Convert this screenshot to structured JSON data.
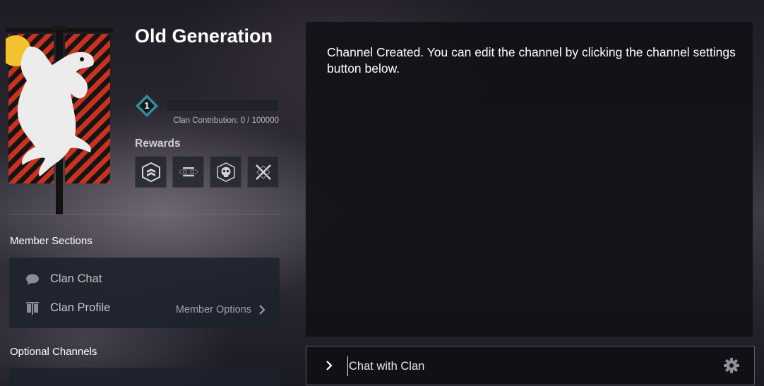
{
  "clan": {
    "name": "Old Generation",
    "level": "1",
    "progress": 0,
    "contribution_text": "Clan Contribution: 0 / 100000",
    "rewards_label": "Rewards",
    "rewards": [
      "shield-emblem-icon",
      "engram-icon",
      "skull-emblem-icon",
      "crossed-swords-icon"
    ]
  },
  "member_sections": {
    "title": "Member Sections",
    "items": [
      {
        "label": "Clan Chat",
        "icon": "chat-bubble-icon"
      },
      {
        "label": "Clan Profile",
        "icon": "banner-icon"
      }
    ],
    "options_label": "Member Options"
  },
  "optional_channels": {
    "title": "Optional Channels"
  },
  "chat": {
    "message": "Channel Created. You can edit the channel by clicking the channel settings button below.",
    "input_placeholder": "Chat with Clan"
  },
  "colors": {
    "banner_red": "#c8321f",
    "banner_black": "#151515",
    "sun_yellow": "#f2c12e",
    "level_teal": "#2f8fa0"
  }
}
